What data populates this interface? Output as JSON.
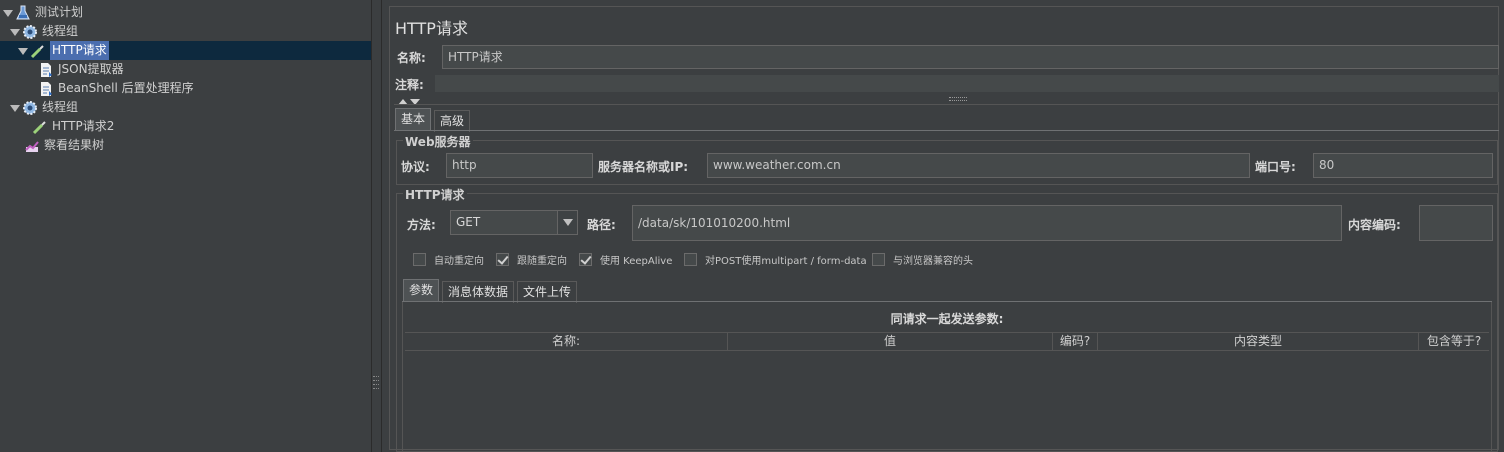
{
  "tree": {
    "nodes": [
      {
        "label": "测试计划",
        "icon": "flask-icon"
      },
      {
        "label": "线程组",
        "icon": "gear-icon"
      },
      {
        "label": "HTTP请求",
        "icon": "pipette-icon"
      },
      {
        "label": "JSON提取器",
        "icon": "document-icon"
      },
      {
        "label": "BeanShell 后置处理程序",
        "icon": "document-icon"
      },
      {
        "label": "线程组",
        "icon": "gear-icon"
      },
      {
        "label": "HTTP请求2",
        "icon": "pipette-icon"
      },
      {
        "label": "察看结果树",
        "icon": "chart-icon"
      }
    ]
  },
  "sampler": {
    "title": "HTTP请求",
    "name_label": "名称:",
    "name_value": "HTTP请求",
    "comment_label": "注释:",
    "comment_value": ""
  },
  "tabs": {
    "basic": "基本",
    "advanced": "高级"
  },
  "web_server": {
    "group_title": "Web服务器",
    "protocol_label": "协议:",
    "protocol_value": "http",
    "server_label": "服务器名称或IP:",
    "server_value": "www.weather.com.cn",
    "port_label": "端口号:",
    "port_value": "80"
  },
  "http_request": {
    "group_title": "HTTP请求",
    "method_label": "方法:",
    "method_value": "GET",
    "path_label": "路径:",
    "path_value": "/data/sk/101010200.html",
    "encoding_label": "内容编码:",
    "encoding_value": ""
  },
  "options": [
    {
      "label": "自动重定向",
      "checked": false
    },
    {
      "label": "跟随重定向",
      "checked": true
    },
    {
      "label": "使用 KeepAlive",
      "checked": true
    },
    {
      "label": "对POST使用multipart / form-data",
      "checked": false
    },
    {
      "label": "与浏览器兼容的头",
      "checked": false
    }
  ],
  "param_tabs": {
    "params": "参数",
    "body": "消息体数据",
    "files": "文件上传"
  },
  "params_table": {
    "caption": "同请求一起发送参数:",
    "columns": [
      "名称:",
      "值",
      "编码?",
      "内容类型",
      "包含等于?"
    ]
  },
  "colors": {
    "background": "#3c3f41",
    "selection": "#4b6eaf",
    "selected_row": "#0d293e"
  }
}
